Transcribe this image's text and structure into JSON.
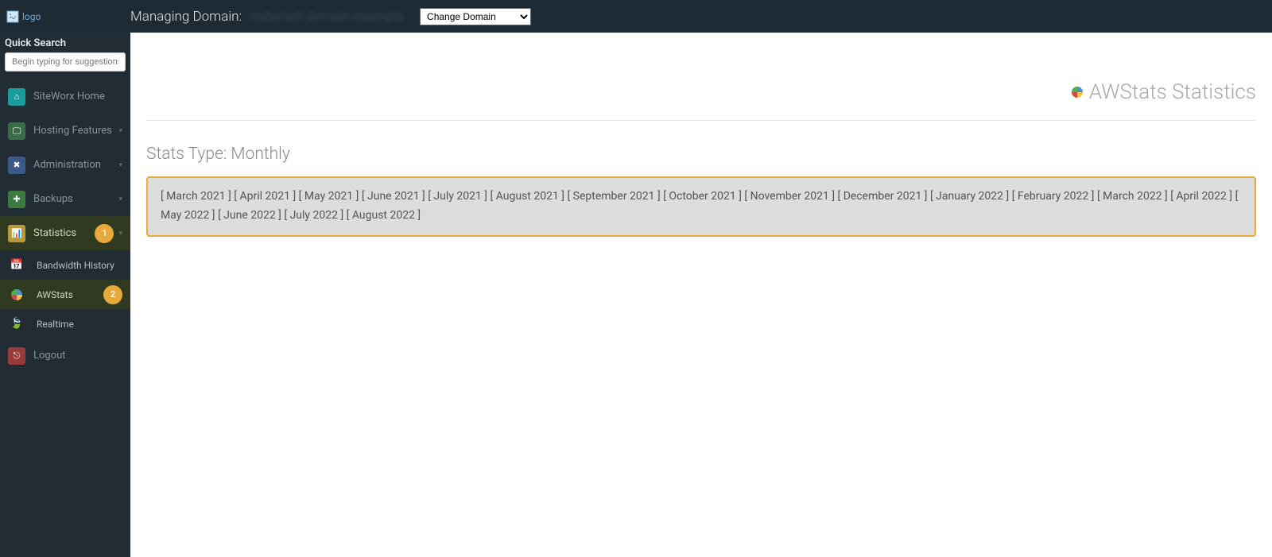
{
  "topbar": {
    "logo_text": "logo",
    "managing_label": "Managing Domain:",
    "domain_name_blurred": "redacted-domain.example",
    "change_domain_label": "Change Domain"
  },
  "sidebar": {
    "quick_search_label": "Quick Search",
    "quick_search_placeholder": "Begin typing for suggestions",
    "items": [
      {
        "label": "SiteWorx Home"
      },
      {
        "label": "Hosting Features"
      },
      {
        "label": "Administration"
      },
      {
        "label": "Backups"
      },
      {
        "label": "Statistics",
        "badge": "1"
      },
      {
        "label": "Bandwidth History"
      },
      {
        "label": "AWStats",
        "badge": "2"
      },
      {
        "label": "Realtime"
      },
      {
        "label": "Logout"
      }
    ]
  },
  "main": {
    "page_title": "AWStats Statistics",
    "stats_type_label": "Stats Type: Monthly",
    "months": [
      "March 2021",
      "April 2021",
      "May 2021",
      "June 2021",
      "July 2021",
      "August 2021",
      "September 2021",
      "October 2021",
      "November 2021",
      "December 2021",
      "January 2022",
      "February 2022",
      "March 2022",
      "April 2022",
      "May 2022",
      "June 2022",
      "July 2022",
      "August 2022"
    ]
  }
}
